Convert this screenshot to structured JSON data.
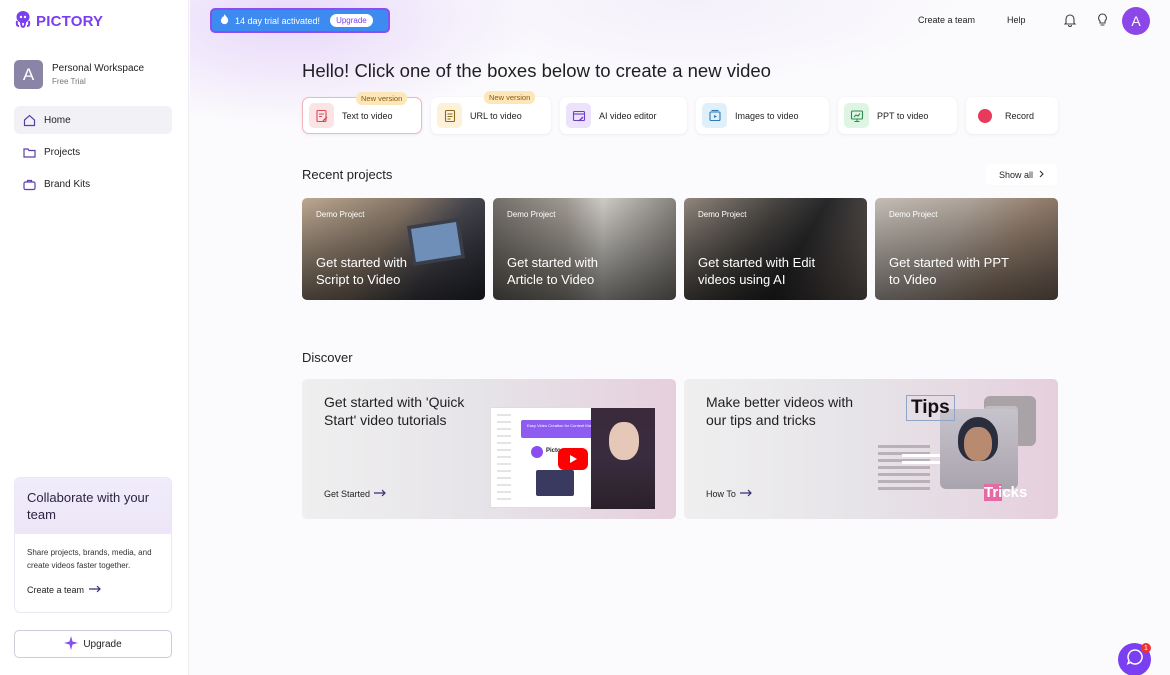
{
  "app": {
    "name": "PICTORY"
  },
  "workspace": {
    "initial": "A",
    "name": "Personal Workspace",
    "plan": "Free Trial"
  },
  "nav": [
    {
      "label": "Home",
      "icon": "home-icon",
      "active": true
    },
    {
      "label": "Projects",
      "icon": "folder-icon",
      "active": false
    },
    {
      "label": "Brand Kits",
      "icon": "briefcase-icon",
      "active": false
    }
  ],
  "collab": {
    "title": "Collaborate with your team",
    "body": "Share projects, brands, media, and create videos faster together.",
    "link": "Create a team"
  },
  "sidebar_upgrade": "Upgrade",
  "trial": {
    "text": "14 day trial activated!",
    "button": "Upgrade"
  },
  "topnav": {
    "create_team": "Create a team",
    "help": "Help",
    "user_initial": "A"
  },
  "headline": "Hello! Click one of the boxes below to create a new video",
  "creators": [
    {
      "label": "Text to video",
      "badge": "New version",
      "icon": "text-to-video-icon",
      "color": "#fde4e4"
    },
    {
      "label": "URL to video",
      "badge": "New version",
      "icon": "document-icon",
      "color": "#fdf1d9"
    },
    {
      "label": "AI video editor",
      "badge": "",
      "icon": "video-editor-icon",
      "color": "#ece2fb"
    },
    {
      "label": "Images to video",
      "badge": "",
      "icon": "images-icon",
      "color": "#dff0fb"
    },
    {
      "label": "PPT to video",
      "badge": "",
      "icon": "presentation-icon",
      "color": "#def5e4"
    },
    {
      "label": "Record",
      "badge": "",
      "icon": "record-icon",
      "color": "#fde4e8"
    }
  ],
  "recent": {
    "title": "Recent projects",
    "show_all": "Show all",
    "items": [
      {
        "tag": "Demo Project",
        "title": "Get started with Script to Video"
      },
      {
        "tag": "Demo Project",
        "title": "Get started with Article to Video"
      },
      {
        "tag": "Demo Project",
        "title": "Get started with Edit videos using AI"
      },
      {
        "tag": "Demo Project",
        "title": "Get started with PPT to Video"
      }
    ]
  },
  "discover": {
    "title": "Discover",
    "cards": [
      {
        "title": "Get started with 'Quick Start' video tutorials",
        "link": "Get Started"
      },
      {
        "title": "Make better videos with our tips and tricks",
        "link": "How To",
        "overlay_top": "Tips",
        "overlay_bottom_hl": "Tri",
        "overlay_bottom": "cks"
      }
    ]
  },
  "tutorial_thumb": {
    "channel": "Pictory",
    "banner": "Easy Video Creation for Content Marketers"
  },
  "chat_badge": "1"
}
